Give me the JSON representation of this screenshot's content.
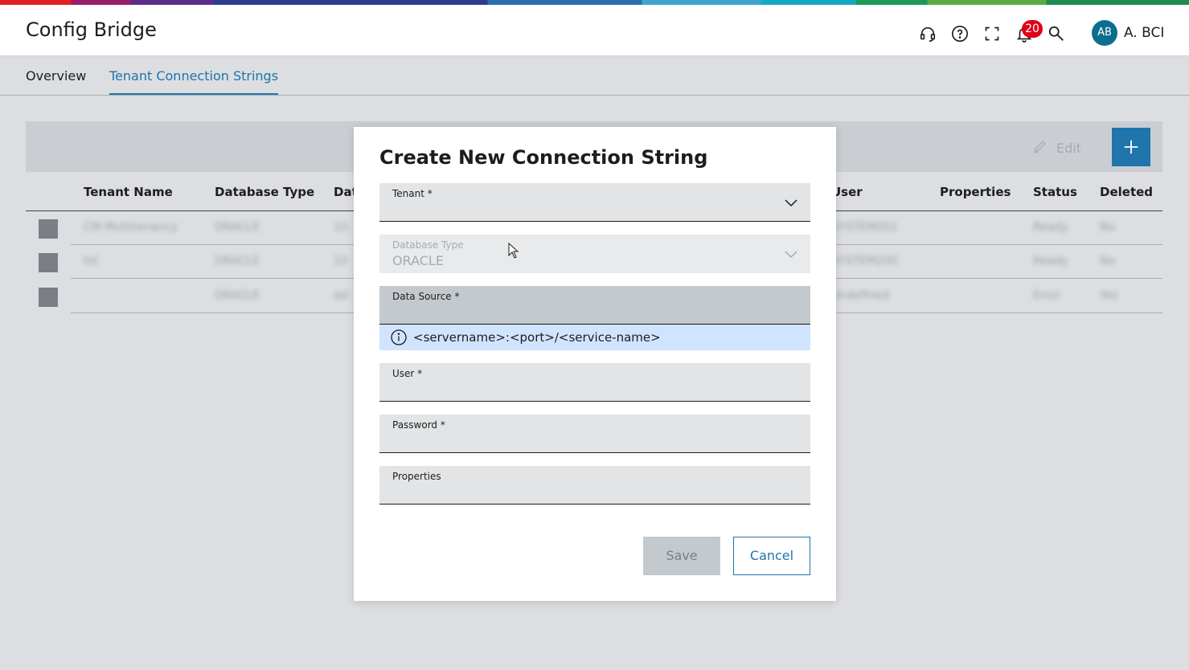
{
  "app": {
    "title": "Config Bridge"
  },
  "header": {
    "notifications_count": "20",
    "avatar_initials": "AB",
    "user_name": "A. BCI",
    "icons": [
      "headset-icon",
      "help-icon",
      "fullscreen-icon",
      "bell-icon",
      "search-icon"
    ]
  },
  "tabs": [
    {
      "label": "Overview",
      "active": false
    },
    {
      "label": "Tenant Connection Strings",
      "active": true
    }
  ],
  "toolbar": {
    "edit_label": "Edit"
  },
  "table": {
    "columns": [
      "Tenant Name",
      "Database Type",
      "Dat",
      "User",
      "Properties",
      "Status",
      "Deleted"
    ],
    "rows": [
      [
        "CM Multitenancy",
        "ORACLE",
        "10",
        "SYSTEM001",
        "",
        "Ready",
        "No"
      ],
      [
        "tst",
        "ORACLE",
        "10",
        "SYSTEM200",
        "",
        "Ready",
        "No"
      ],
      [
        "",
        "ORACLE",
        "ad",
        "Undefined",
        "",
        "Error",
        "Yes"
      ]
    ]
  },
  "dialog": {
    "title": "Create New Connection String",
    "fields": {
      "tenant": {
        "label": "Tenant *",
        "value": ""
      },
      "database_type": {
        "label": "Database Type",
        "value": "ORACLE"
      },
      "data_source": {
        "label": "Data Source *",
        "value": ""
      },
      "data_source_hint": "<servername>:<port>/<service-name>",
      "user": {
        "label": "User *",
        "value": ""
      },
      "password": {
        "label": "Password *",
        "value": ""
      },
      "properties": {
        "label": "Properties",
        "value": ""
      }
    },
    "save_label": "Save",
    "cancel_label": "Cancel"
  },
  "colors": {
    "accent": "#1f75ac",
    "badge": "#e00016",
    "hint_bg": "#d1e4ff"
  }
}
